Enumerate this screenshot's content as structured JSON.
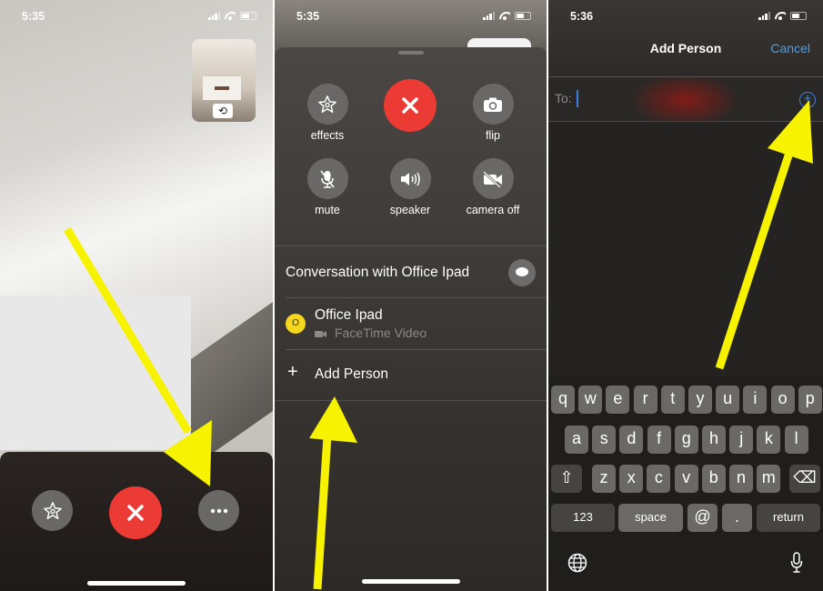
{
  "panel1": {
    "status": {
      "time": "5:35"
    },
    "controls": {
      "effects_icon": "star-effects-icon",
      "end_call_icon": "close-x-icon",
      "more_icon": "ellipsis-icon"
    },
    "pip_flip_glyph": "⟲"
  },
  "panel2": {
    "status": {
      "time": "5:35"
    },
    "controls": [
      {
        "label": "effects",
        "icon": "star-effects-icon",
        "glyph": "✩"
      },
      {
        "label": "",
        "icon": "end-call-icon",
        "glyph": "✕"
      },
      {
        "label": "flip",
        "icon": "camera-flip-icon",
        "glyph": "⟲"
      },
      {
        "label": "mute",
        "icon": "mic-off-icon",
        "glyph": "🎙"
      },
      {
        "label": "speaker",
        "icon": "speaker-icon",
        "glyph": "🔊"
      },
      {
        "label": "camera off",
        "icon": "camera-off-icon",
        "glyph": "📷"
      }
    ],
    "conversation_title": "Conversation with Office Ipad",
    "participant": {
      "avatar_initial": "O",
      "name": "Office Ipad",
      "subtitle": "FaceTime Video",
      "avatar_color": "#f4d61c"
    },
    "add_person_label": "Add Person",
    "add_person_glyph": "+"
  },
  "panel3": {
    "status": {
      "time": "5:36"
    },
    "title": "Add Person",
    "cancel_label": "Cancel",
    "to_label": "To:",
    "to_value": "",
    "add_contact_glyph": "+",
    "accent_color": "#4aa1f0",
    "keyboard": {
      "row1": [
        "q",
        "w",
        "e",
        "r",
        "t",
        "y",
        "u",
        "i",
        "o",
        "p"
      ],
      "row2": [
        "a",
        "s",
        "d",
        "f",
        "g",
        "h",
        "j",
        "k",
        "l"
      ],
      "row3": [
        "z",
        "x",
        "c",
        "v",
        "b",
        "n",
        "m"
      ],
      "shift_glyph": "⇧",
      "delete_glyph": "⌫",
      "numbers_label": "123",
      "space_label": "space",
      "at_label": "@",
      "dot_label": ".",
      "return_label": "return",
      "globe_glyph": "🌐",
      "mic_glyph": "🎙"
    }
  },
  "annotation_color": "#f7f300"
}
